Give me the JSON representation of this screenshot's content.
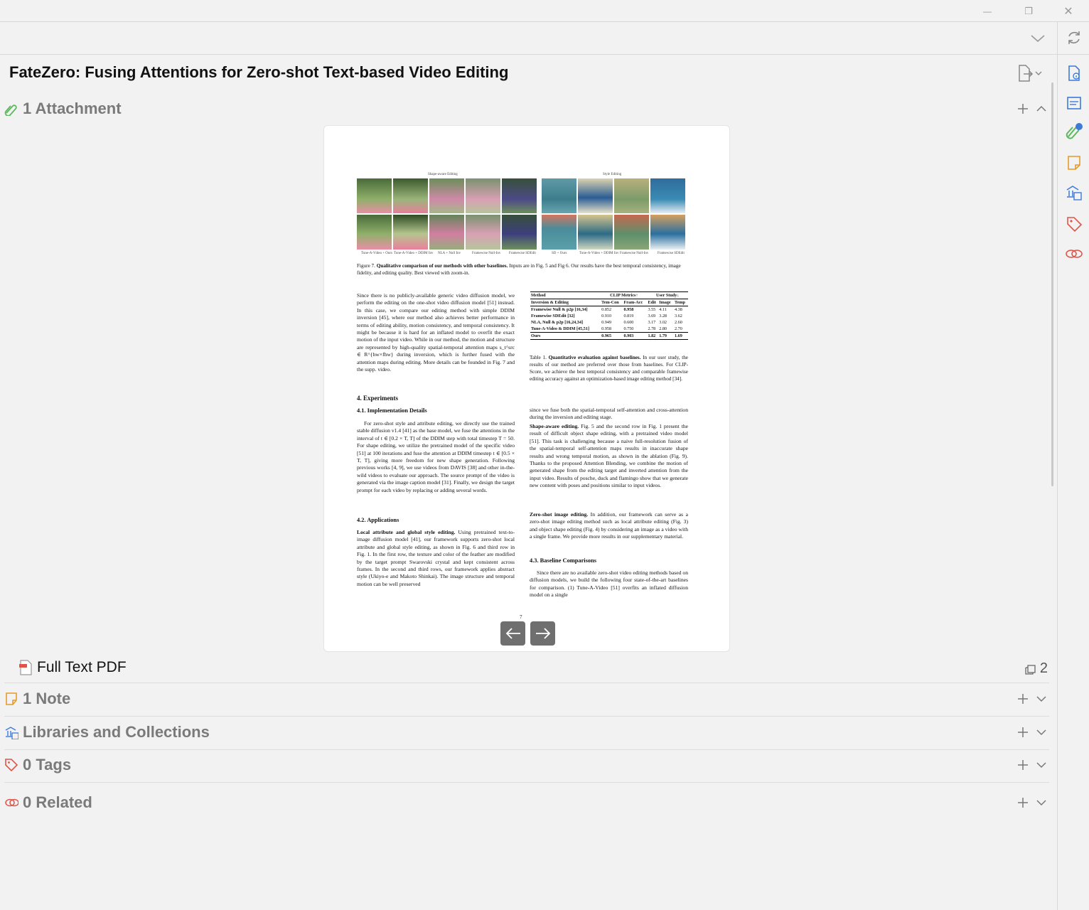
{
  "window": {
    "minimize": "—",
    "restore": "❐",
    "close": "✕"
  },
  "item": {
    "title": "FateZero: Fusing Attentions for Zero-shot Text-based Video Editing"
  },
  "sections": {
    "attachments": {
      "label": "1 Attachment"
    },
    "notes": {
      "label": "1 Note"
    },
    "libraries": {
      "label": "Libraries and Collections"
    },
    "tags": {
      "label": "0 Tags"
    },
    "related": {
      "label": "0 Related"
    }
  },
  "attachment": {
    "label": "Full Text PDF",
    "annotation_count": "2"
  },
  "paper_page": {
    "fig_titles": [
      "Shape-aware Editing",
      "Style Editing"
    ],
    "fig_labels": [
      "Tune-A-Video + Ours",
      "Tune-A-Video + DDIM Inv",
      "NLA + Null Inv",
      "Framewise Null-Inv",
      "Framewise SDEdit",
      "SD + Ours",
      "Tune-A-Video + DDIM Inv",
      "Framewise Null-Inv",
      "Framewise SDEdit"
    ],
    "figure_caption_bold": "Qualitative comparison of our methods with other baselines.",
    "figure_caption_prefix": "Figure 7.",
    "figure_caption_rest": " Inputs are in Fig. 5 and Fig 6. Our results have the best temporal consistency, image fidelity, and editing quality. Best viewed with zoom-in.",
    "left_para1": "Since there is no publicly-available generic video diffusion model, we perform the editing on the one-shot video diffusion model [51] instead. In this case, we compare our editing method with simple DDIM inversion [45], where our method also achieves better performance in terms of editing ability, motion consistency, and temporal consistency. It might be because it is hard for an inflated model to overfit the exact motion of the input video. While in our method, the motion and structure are represented by high-quality spatial-temporal attention maps s_t^src ∈ R^{hw×fhw} during inversion, which is further fused with the attention maps during editing. More details can be founded in Fig. 7 and the supp. video.",
    "h_experiments": "4. Experiments",
    "h_impl": "4.1. Implementation Details",
    "impl_para": "For zero-shot style and attribute editing, we directly use the trained stable diffusion v1.4 [41] as the base model, we fuse the attentions in the interval of t ∈ [0.2 × T, T] of the DDIM step with total timestep T = 50. For shape editing, we utilize the pretrained model of the specific video [51] at 100 iterations and fuse the attention at DDIM timestep t ∈ [0.5 × T, T], giving more freedom for new shape generation. Following previous works [4, 9], we use videos from DAVIS [38] and other in-the-wild videos to evaluate our approach. The source prompt of the video is generated via the image caption model [31]. Finally, we design the target prompt for each video by replacing or adding several words.",
    "h_apps": "4.2. Applications",
    "apps_bold": "Local attribute and global style editing.",
    "apps_para": " Using pretrained text-to-image diffusion model [41], our framework supports zero-shot local attribute and global style editing, as shown in Fig. 6 and third row in Fig. 1. In the first row, the texture and color of the feather are modified by the target prompt Swarovski crystal and kept consistent across frames. In the second and third rows, our framework applies abstract style (Ukiyo-e and Makoto Shinkai). The image structure and temporal motion can be well preserved",
    "table_caption_prefix": "Table 1.",
    "table_caption_bold": "Quantitative evaluation against baselines.",
    "table_caption_rest": " In our user study, the results of our method are preferred over those from baselines. For CLIP-Score, we achieve the best temporal consistency and comparable framewise editing accuracy against an optimization-based image editing method [34].",
    "table_headers": [
      "Method",
      "CLIP Metrics↑",
      "User Study↓"
    ],
    "table_subheaders": [
      "Inversion & Editing",
      "Tem-Con",
      "Fram-Acc",
      "Edit",
      "Image",
      "Temp"
    ],
    "table_rows": [
      [
        "Framewise Null & p2p [16,34]",
        "0.852",
        "0.958",
        "3.55",
        "4.11",
        "4.38"
      ],
      [
        "Framewise SDEdit [32]",
        "0.910",
        "0.819",
        "3.69",
        "3.28",
        "3.62"
      ],
      [
        "NLA, Null & p2p [16,24,34]",
        "0.949",
        "0.600",
        "3.17",
        "3.02",
        "2.60"
      ],
      [
        "Tune-A-Video & DDIM [45,51]",
        "0.958",
        "0.750",
        "2.78",
        "2.80",
        "2.70"
      ],
      [
        "Ours",
        "0.965",
        "0.903",
        "1.82",
        "1.79",
        "1.69"
      ]
    ],
    "right_para1": "since we fuse both the spatial-temporal self-attention and cross-attention during the inversion and editing stage.",
    "shape_bold": "Shape-aware editing.",
    "shape_para": " Fig. 5 and the second row in Fig. 1 present the result of difficult object shape editing, with a pretrained video model [51]. This task is challenging because a naive full-resolution fusion of the spatial-temporal self-attention maps results in inaccurate shape results and wrong temporal motion, as shown in the ablation (Fig. 9). Thanks to the proposed Attention Blending, we combine the motion of generated shape from the editing target and inverted attention from the input video. Results of posche, duck and flamingo show that we generate new content with poses and positions similar to input videos.",
    "zs_bold": "Zero-shot image editing.",
    "zs_para": " In addition, our framework can serve as a zero-shot image editing method such as local attribute editing (Fig. 3) and object shape editing (Fig. 4) by considering an image as a video with a single frame. We provide more results in our supplementary material.",
    "h_baseline": "4.3. Baseline Comparisons",
    "baseline_para": "Since there are no available zero-shot video editing methods based on diffusion models, we build the following four state-of-the-art baselines for comparison. (1) Tune-A-Video [51] overfits an inflated diffusion model on a single",
    "page_number": "7"
  },
  "colors": {
    "accent_blue": "#3d7bd9",
    "green": "#5cb85c",
    "orange": "#e69a2a",
    "red": "#e0554a",
    "nav_button": "#6f6f6f"
  },
  "icons": {
    "sidebar": [
      "info-icon",
      "abstract-icon",
      "attachments-icon",
      "notes-icon",
      "libraries-icon",
      "tags-icon",
      "related-icon"
    ]
  }
}
